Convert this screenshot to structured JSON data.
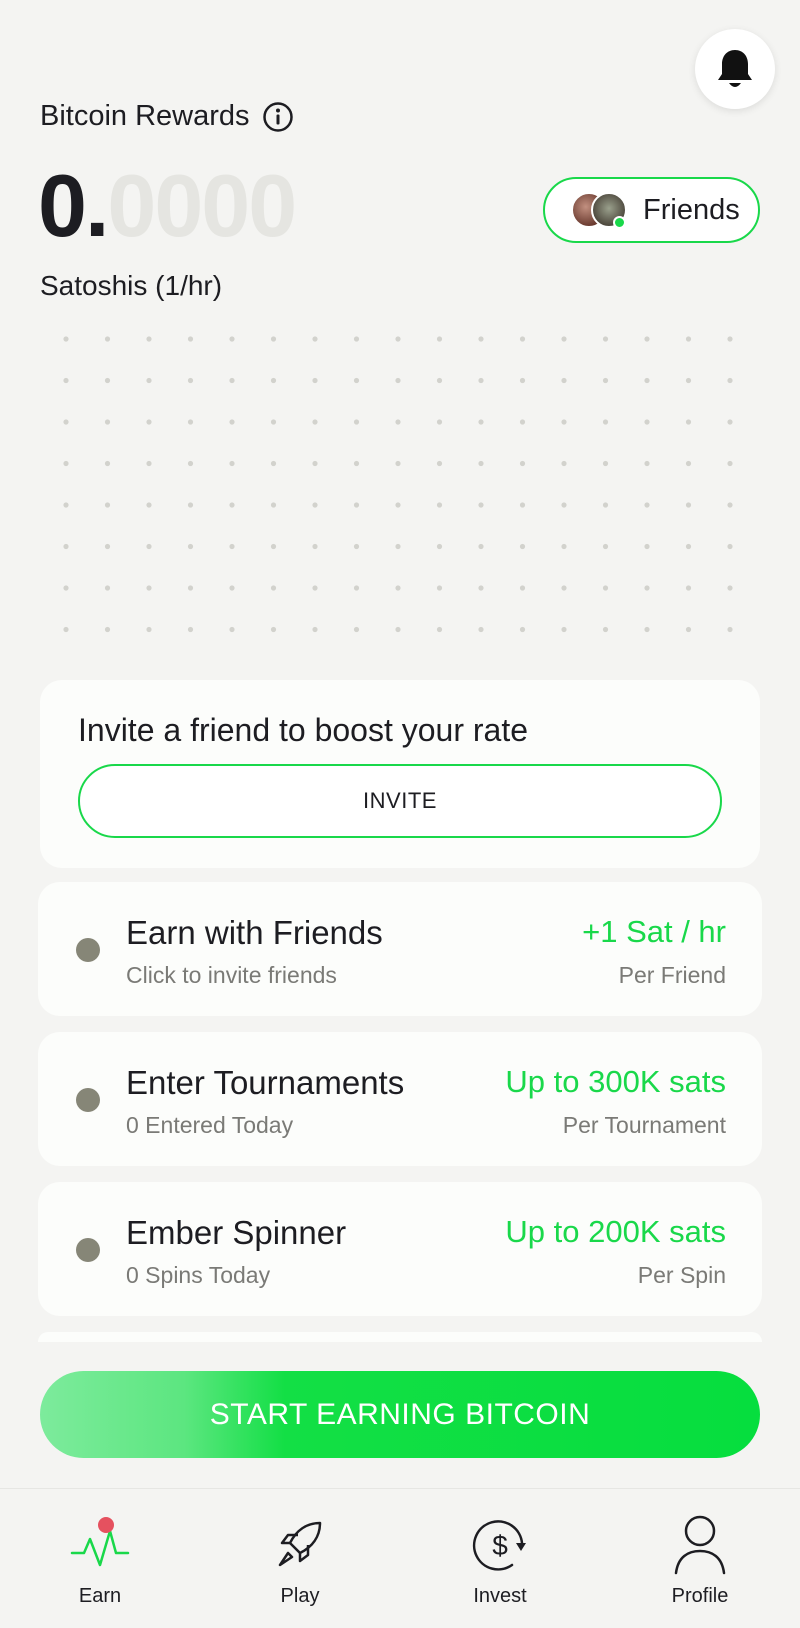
{
  "header": {
    "title": "Bitcoin Rewards",
    "balance_int": "0.",
    "balance_dec": "0000",
    "units": "Satoshis (1/hr)",
    "friends_label": "Friends"
  },
  "invite": {
    "heading": "Invite a friend to boost your rate",
    "button": "INVITE"
  },
  "tasks": [
    {
      "title": "Earn with Friends",
      "subtitle": "Click to invite friends",
      "reward": "+1 Sat / hr",
      "per": "Per Friend"
    },
    {
      "title": "Enter Tournaments",
      "subtitle": "0 Entered Today",
      "reward": "Up to 300K sats",
      "per": "Per Tournament"
    },
    {
      "title": "Ember Spinner",
      "subtitle": "0 Spins Today",
      "reward": "Up to 200K sats",
      "per": "Per Spin"
    }
  ],
  "cta": {
    "label": "START EARNING BITCOIN"
  },
  "tabs": [
    {
      "label": "Earn",
      "icon": "pulse-icon"
    },
    {
      "label": "Play",
      "icon": "rocket-icon"
    },
    {
      "label": "Invest",
      "icon": "dollar-cycle-icon"
    },
    {
      "label": "Profile",
      "icon": "user-icon"
    }
  ],
  "colors": {
    "accent": "#19d84a",
    "background": "#f4f4f2",
    "badge": "#e5515f"
  }
}
